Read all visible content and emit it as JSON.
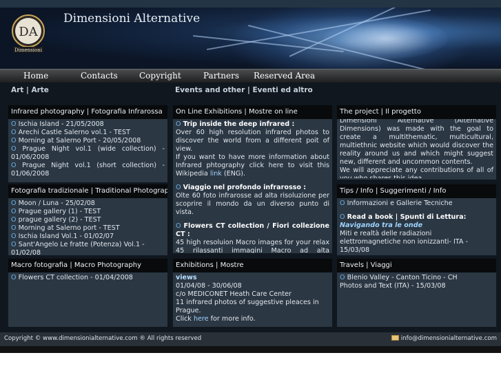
{
  "site": {
    "title": "Dimensioni Alternative",
    "logo_letters": "DA",
    "logo_caption": "Dimensioni"
  },
  "nav": {
    "items": [
      "Home",
      "Contacts",
      "Copyright",
      "Partners",
      "Reserved Area"
    ]
  },
  "columns": {
    "left_heading_1": "Art",
    "left_heading_sep": "|",
    "left_heading_2": "Arte",
    "middle_heading_1": "Events and other",
    "middle_heading_sep": "|",
    "middle_heading_2": "Eventi ed altro"
  },
  "panels": {
    "infrared": {
      "title": "Infrared photography | Fotografia Infrarossa",
      "items": [
        "Ischia Island - 21/05/2008",
        "Arechi Castle Salerno vol.1 - TEST",
        "Morning at Salerno Port - 20/05/2008",
        "Prague Night vol.1 (wide collection) - 01/06/2008",
        "Prague Night vol.1 (short collection) - 01/06/2008"
      ]
    },
    "traditional": {
      "title": "Fotografia tradizionale | Traditional Photography",
      "items": [
        "Moon / Luna - 25/02/08",
        "Prague gallery (1) - TEST",
        "prague gallery (2) - TEST",
        "Morning at Salerno port - TEST",
        "Ischia Island Vol.1 - 01/02/07",
        "Sant'Angelo Le fratte (Potenza) Vol.1 - 01/02/08"
      ]
    },
    "macro": {
      "title": "Macro fotografia | Macro Photography",
      "items": [
        "Flowers CT collection - 01/04/2008"
      ]
    },
    "online": {
      "title": "On Line Exhibitions | Mostre on line",
      "trip_title": "Trip inside the deep infrared :",
      "trip_text_1": "Over 60 high resolution infrared photos to discover the world from a different poit of view.",
      "trip_text_2": "If you want to have more information about Infrared phtography click here to visit this Wikipedia",
      "trip_link": "link",
      "trip_text_3": "(ENG).",
      "viaggio_title": "Viaggio nel profondo infrarosso :",
      "viaggio_text": "Olte 60 foto infrarosse ad alta risoluzione per scoprire il mondo da un diverso punto di vista.",
      "flowers_title": "Flowers CT collection / Fiori collezione CT :",
      "flowers_text": "45 high resoluion Macro images for your relax 45 rilassanti immagini Macro ad alta risoluzione."
    },
    "exhibitions": {
      "title": "Exhibitions | Mostre",
      "views_label": "views",
      "dates": "01/04/08 - 30/06/08",
      "place": "c/o MEDICONET Heath Care Center",
      "desc": "11 infrared photos of suggestive pleaces in Prague.",
      "click": "Click",
      "here": "here",
      "more": "for more info."
    },
    "project": {
      "title": "The project | Il progetto",
      "text_1": "Dimensioni Alternative (Alternative Dimensions) was made with the goal to create a multithematic, multicultural, multiethnic website which would discover the reality around us and which might suggest new, different and uncommon contents.",
      "text_2": "We will appreciate any contributions of all of you who shares this idea."
    },
    "tips": {
      "title": "Tips / Info | Suggerimenti / Info",
      "item_1": "Informazioni e Gallerie Tecniche",
      "read_title": "Read a book | Spunti di Lettura:",
      "book_title": "Navigando tra le onde",
      "book_desc": "Miti e realtà delle radiazioni elettromagnetiche non ionizzanti- ITA - 15/03/08"
    },
    "travels": {
      "title": "Travels | Viaggi",
      "item_1": "Blenio Valley - Canton Ticino - CH",
      "item_2": "Photos and Text (ITA) - 15/03/08"
    }
  },
  "footer": {
    "copyright": "Copyright © www.dimensionialternative.com ® All rights reserved",
    "email": "info@dimensionialternative.com",
    "email_icon": "envelope-icon"
  },
  "colors": {
    "panel_bg": "#2b3743",
    "title_bg": "#080a0c",
    "bullet": "#6fb3e6",
    "link": "#9fd4ff"
  }
}
